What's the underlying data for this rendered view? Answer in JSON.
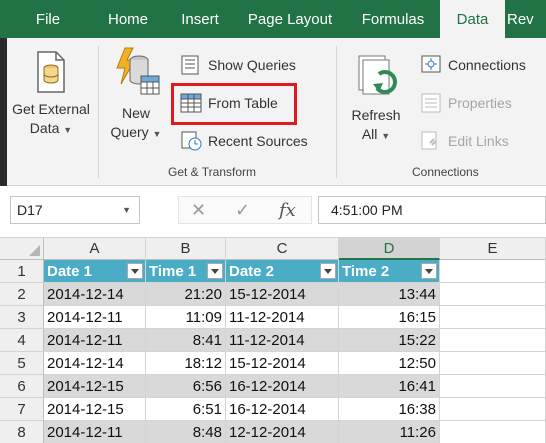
{
  "tabs": [
    {
      "label": "File"
    },
    {
      "label": "Home"
    },
    {
      "label": "Insert"
    },
    {
      "label": "Page Layout"
    },
    {
      "label": "Formulas"
    },
    {
      "label": "Data",
      "active": true
    },
    {
      "label": "Rev"
    }
  ],
  "ribbon": {
    "get_external_data": {
      "line1": "Get External",
      "line2": "Data"
    },
    "new_query": {
      "line1": "New",
      "line2": "Query"
    },
    "show_queries": "Show Queries",
    "from_table": "From Table",
    "recent_sources": "Recent Sources",
    "get_transform_label": "Get & Transform",
    "refresh_all": {
      "line1": "Refresh",
      "line2": "All"
    },
    "connections": "Connections",
    "properties": "Properties",
    "edit_links": "Edit Links",
    "connections_group_label": "Connections"
  },
  "formula_bar": {
    "name_box": "D17",
    "cancel_icon": "✕",
    "enter_icon": "✓",
    "fx_icon": "fx",
    "value": "4:51:00 PM"
  },
  "sheet": {
    "columns": [
      "A",
      "B",
      "C",
      "D",
      "E"
    ],
    "selected_column": "D",
    "table_headers": [
      "Date 1",
      "Time 1",
      "Date 2",
      "Time 2"
    ],
    "row_numbers": [
      "1",
      "2",
      "3",
      "4",
      "5",
      "6",
      "7",
      "8"
    ],
    "rows": [
      [
        "2014-12-14",
        "21:20",
        "15-12-2014",
        "13:44"
      ],
      [
        "2014-12-11",
        "11:09",
        "11-12-2014",
        "16:15"
      ],
      [
        "2014-12-11",
        "8:41",
        "11-12-2014",
        "15:22"
      ],
      [
        "2014-12-14",
        "18:12",
        "15-12-2014",
        "12:50"
      ],
      [
        "2014-12-15",
        "6:56",
        "16-12-2014",
        "16:41"
      ],
      [
        "2014-12-15",
        "6:51",
        "16-12-2014",
        "16:38"
      ],
      [
        "2014-12-11",
        "8:48",
        "12-12-2014",
        "11:26"
      ]
    ]
  },
  "colors": {
    "accent": "#217346",
    "table_header": "#4bacc6",
    "highlight_box": "#e0191e",
    "band_row": "#d9d9d9"
  }
}
